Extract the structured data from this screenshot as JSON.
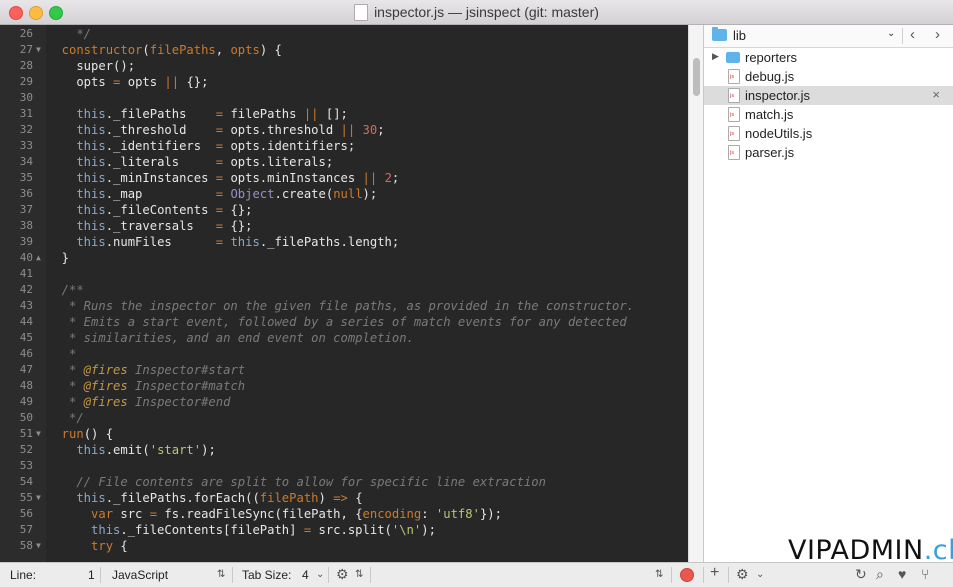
{
  "window": {
    "title": "inspector.js — jsinspect (git: master)",
    "title_icon": "js-file-icon"
  },
  "editor": {
    "lines": [
      {
        "n": "26",
        "fold": "",
        "segs": [
          [
            "cm",
            "    */"
          ]
        ]
      },
      {
        "n": "27",
        "fold": "▼",
        "segs": [
          [
            "kw",
            "  constructor"
          ],
          [
            "p",
            "("
          ],
          [
            "kw",
            "filePaths"
          ],
          [
            "p",
            ", "
          ],
          [
            "kw",
            "opts"
          ],
          [
            "p",
            ") {"
          ]
        ]
      },
      {
        "n": "28",
        "fold": "",
        "segs": [
          [
            "p",
            "    super();"
          ]
        ]
      },
      {
        "n": "29",
        "fold": "",
        "segs": [
          [
            "p",
            "    opts "
          ],
          [
            "op",
            "="
          ],
          [
            "p",
            " opts "
          ],
          [
            "op",
            "||"
          ],
          [
            "p",
            " {};"
          ]
        ]
      },
      {
        "n": "30",
        "fold": "",
        "segs": [
          [
            "p",
            ""
          ]
        ]
      },
      {
        "n": "31",
        "fold": "",
        "segs": [
          [
            "th",
            "    this"
          ],
          [
            "p",
            "._filePaths    "
          ],
          [
            "op",
            "="
          ],
          [
            "p",
            " filePaths "
          ],
          [
            "op",
            "||"
          ],
          [
            "p",
            " [];"
          ]
        ]
      },
      {
        "n": "32",
        "fold": "",
        "segs": [
          [
            "th",
            "    this"
          ],
          [
            "p",
            "._threshold    "
          ],
          [
            "op",
            "="
          ],
          [
            "p",
            " opts.threshold "
          ],
          [
            "op",
            "||"
          ],
          [
            "p",
            " "
          ],
          [
            "num",
            "30"
          ],
          [
            "p",
            ";"
          ]
        ]
      },
      {
        "n": "33",
        "fold": "",
        "segs": [
          [
            "th",
            "    this"
          ],
          [
            "p",
            "._identifiers  "
          ],
          [
            "op",
            "="
          ],
          [
            "p",
            " opts.identifiers;"
          ]
        ]
      },
      {
        "n": "34",
        "fold": "",
        "segs": [
          [
            "th",
            "    this"
          ],
          [
            "p",
            "._literals     "
          ],
          [
            "op",
            "="
          ],
          [
            "p",
            " opts.literals;"
          ]
        ]
      },
      {
        "n": "35",
        "fold": "",
        "segs": [
          [
            "th",
            "    this"
          ],
          [
            "p",
            "._minInstances "
          ],
          [
            "op",
            "="
          ],
          [
            "p",
            " opts.minInstances "
          ],
          [
            "op",
            "||"
          ],
          [
            "p",
            " "
          ],
          [
            "num",
            "2"
          ],
          [
            "p",
            ";"
          ]
        ]
      },
      {
        "n": "36",
        "fold": "",
        "segs": [
          [
            "th",
            "    this"
          ],
          [
            "p",
            "._map          "
          ],
          [
            "op",
            "="
          ],
          [
            "p",
            " "
          ],
          [
            "obj",
            "Object"
          ],
          [
            "p",
            ".create("
          ],
          [
            "kw",
            "null"
          ],
          [
            "p",
            ");"
          ]
        ]
      },
      {
        "n": "37",
        "fold": "",
        "segs": [
          [
            "th",
            "    this"
          ],
          [
            "p",
            "._fileContents "
          ],
          [
            "op",
            "="
          ],
          [
            "p",
            " {};"
          ]
        ]
      },
      {
        "n": "38",
        "fold": "",
        "segs": [
          [
            "th",
            "    this"
          ],
          [
            "p",
            "._traversals   "
          ],
          [
            "op",
            "="
          ],
          [
            "p",
            " {};"
          ]
        ]
      },
      {
        "n": "39",
        "fold": "",
        "segs": [
          [
            "th",
            "    this"
          ],
          [
            "p",
            ".numFiles      "
          ],
          [
            "op",
            "="
          ],
          [
            "p",
            " "
          ],
          [
            "th",
            "this"
          ],
          [
            "p",
            "._filePaths.length;"
          ]
        ]
      },
      {
        "n": "40",
        "fold": "▲",
        "segs": [
          [
            "p",
            "  }"
          ]
        ]
      },
      {
        "n": "41",
        "fold": "",
        "segs": [
          [
            "p",
            ""
          ]
        ]
      },
      {
        "n": "42",
        "fold": "",
        "segs": [
          [
            "cm",
            "  /**"
          ]
        ]
      },
      {
        "n": "43",
        "fold": "",
        "segs": [
          [
            "cm",
            "   * Runs the inspector on the given file paths, as provided in the constructor."
          ]
        ]
      },
      {
        "n": "44",
        "fold": "",
        "segs": [
          [
            "cm",
            "   * Emits a start event, followed by a series of match events for any detected"
          ]
        ]
      },
      {
        "n": "45",
        "fold": "",
        "segs": [
          [
            "cm",
            "   * similarities, and an end event on completion."
          ]
        ]
      },
      {
        "n": "46",
        "fold": "",
        "segs": [
          [
            "cm",
            "   *"
          ]
        ]
      },
      {
        "n": "47",
        "fold": "",
        "segs": [
          [
            "cm",
            "   * "
          ],
          [
            "tag",
            "@fires"
          ],
          [
            "cm",
            " Inspector#start"
          ]
        ]
      },
      {
        "n": "48",
        "fold": "",
        "segs": [
          [
            "cm",
            "   * "
          ],
          [
            "tag",
            "@fires"
          ],
          [
            "cm",
            " Inspector#match"
          ]
        ]
      },
      {
        "n": "49",
        "fold": "",
        "segs": [
          [
            "cm",
            "   * "
          ],
          [
            "tag",
            "@fires"
          ],
          [
            "cm",
            " Inspector#end"
          ]
        ]
      },
      {
        "n": "50",
        "fold": "",
        "segs": [
          [
            "cm",
            "   */"
          ]
        ]
      },
      {
        "n": "51",
        "fold": "▼",
        "segs": [
          [
            "kw",
            "  run"
          ],
          [
            "p",
            "() {"
          ]
        ]
      },
      {
        "n": "52",
        "fold": "",
        "segs": [
          [
            "th",
            "    this"
          ],
          [
            "p",
            ".emit("
          ],
          [
            "str",
            "'start'"
          ],
          [
            "p",
            ");"
          ]
        ]
      },
      {
        "n": "53",
        "fold": "",
        "segs": [
          [
            "p",
            ""
          ]
        ]
      },
      {
        "n": "54",
        "fold": "",
        "segs": [
          [
            "cm",
            "    // File contents are split to allow for specific line extraction"
          ]
        ]
      },
      {
        "n": "55",
        "fold": "▼",
        "segs": [
          [
            "th",
            "    this"
          ],
          [
            "p",
            "._filePaths.forEach(("
          ],
          [
            "kw",
            "filePath"
          ],
          [
            "p",
            ") "
          ],
          [
            "op",
            "=>"
          ],
          [
            "p",
            " {"
          ]
        ]
      },
      {
        "n": "56",
        "fold": "",
        "segs": [
          [
            "kw",
            "      var"
          ],
          [
            "p",
            " src "
          ],
          [
            "op",
            "="
          ],
          [
            "p",
            " fs.readFileSync(filePath, {"
          ],
          [
            "kw",
            "encoding"
          ],
          [
            "p",
            ": "
          ],
          [
            "str",
            "'utf8'"
          ],
          [
            "p",
            "});"
          ]
        ]
      },
      {
        "n": "57",
        "fold": "",
        "segs": [
          [
            "th",
            "      this"
          ],
          [
            "p",
            "._fileContents[filePath] "
          ],
          [
            "op",
            "="
          ],
          [
            "p",
            " src.split("
          ],
          [
            "str",
            "'\\n'"
          ],
          [
            "p",
            ");"
          ]
        ]
      },
      {
        "n": "58",
        "fold": "▼",
        "segs": [
          [
            "kw",
            "      try"
          ],
          [
            "p",
            " {"
          ]
        ]
      }
    ]
  },
  "sidebar": {
    "folder": "lib",
    "items": [
      {
        "label": "reporters",
        "type": "folder",
        "selected": false
      },
      {
        "label": "debug.js",
        "type": "file",
        "selected": false
      },
      {
        "label": "inspector.js",
        "type": "file",
        "selected": true
      },
      {
        "label": "match.js",
        "type": "file",
        "selected": false
      },
      {
        "label": "nodeUtils.js",
        "type": "file",
        "selected": false
      },
      {
        "label": "parser.js",
        "type": "file",
        "selected": false
      }
    ],
    "nav_back": "‹",
    "nav_forward": "›",
    "close_glyph": "×"
  },
  "statusbar": {
    "line_label": "Line:",
    "line_value": "1",
    "language": "JavaScript",
    "tab_label": "Tab Size:",
    "tab_value": "4"
  },
  "watermark": {
    "part1": "VIPADMIN",
    "part2": ".club"
  },
  "colors": {
    "editor_bg": "#272727",
    "keyword": "#cc7a2b",
    "comment": "#7a7a7a",
    "string": "#b6c870",
    "number": "#d66a5a",
    "this": "#8aa8c8"
  }
}
